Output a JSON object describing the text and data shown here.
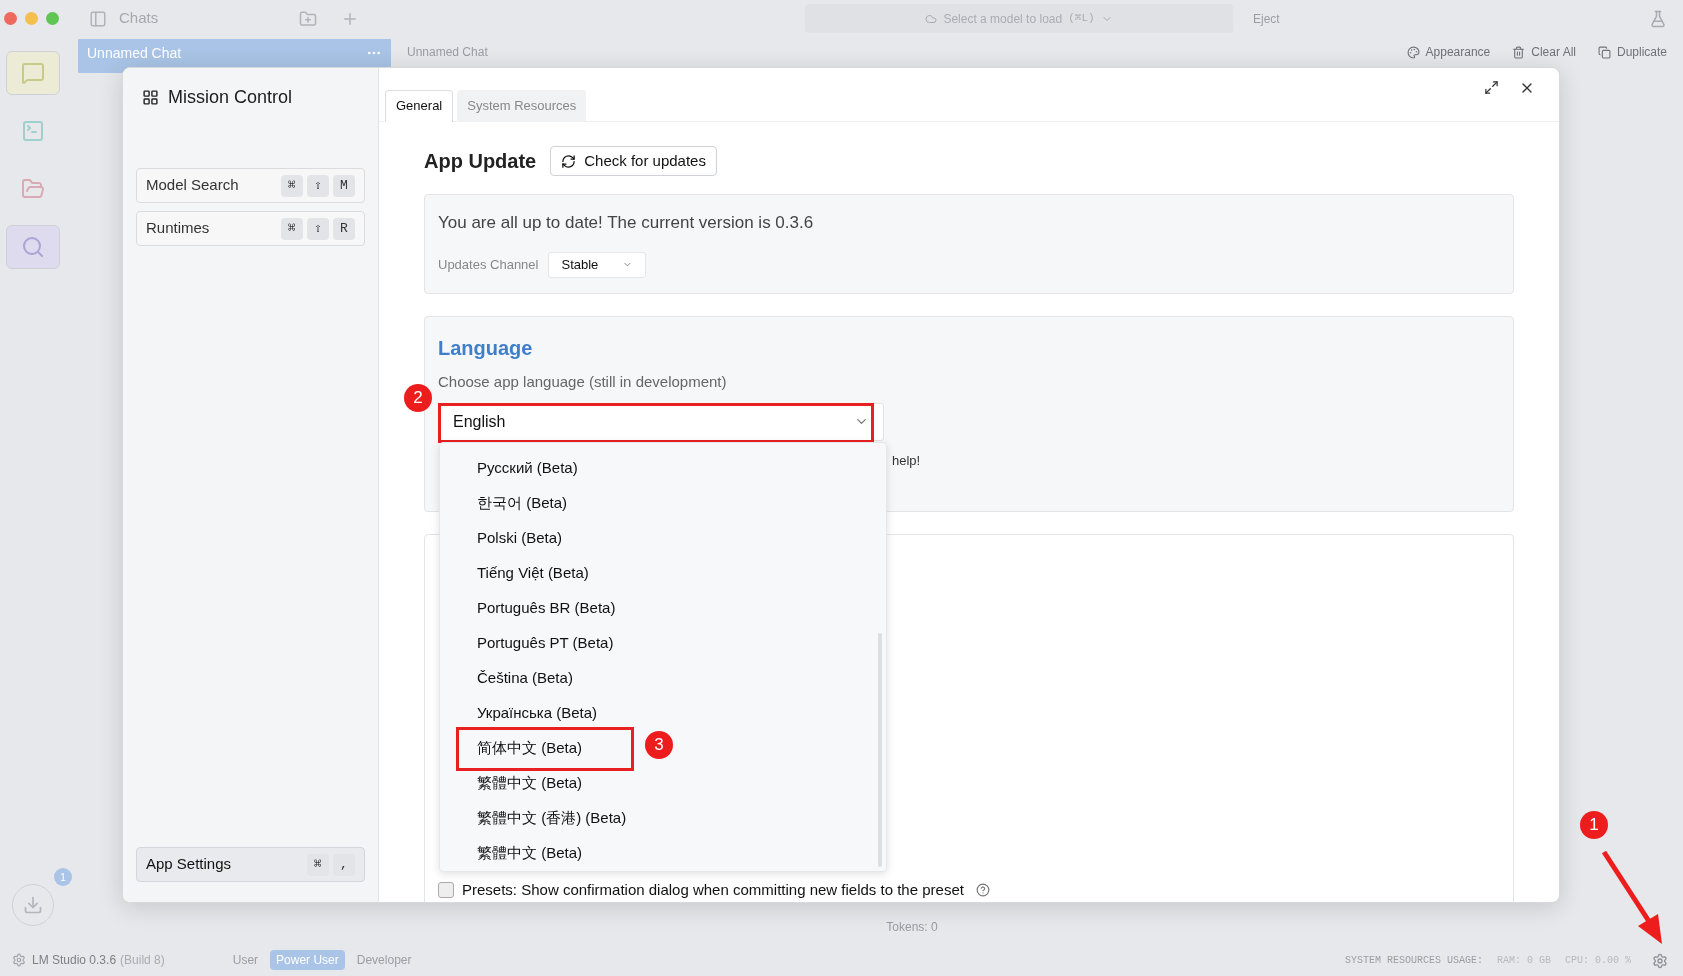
{
  "titlebar": {
    "title": "Chats",
    "model_picker": "Select a model to load",
    "model_shortcut": "(⌘L)",
    "eject": "Eject"
  },
  "sidebar": {
    "items": [
      {
        "kind": "chat",
        "highlighted": true
      },
      {
        "kind": "terminal",
        "highlighted": false
      },
      {
        "kind": "folder",
        "highlighted": false
      },
      {
        "kind": "search",
        "highlighted": true
      }
    ]
  },
  "chat_tabs": [
    {
      "label": "Unnamed Chat",
      "selected": true
    },
    {
      "label": "Unnamed Chat",
      "selected": false
    }
  ],
  "chat_actions": [
    {
      "kind": "appearance",
      "label": "Appearance"
    },
    {
      "kind": "clear",
      "label": "Clear All"
    },
    {
      "kind": "duplicate",
      "label": "Duplicate"
    }
  ],
  "tokens": "Tokens: 0",
  "downloads": {
    "badge": "1"
  },
  "status_bar": {
    "app": "LM Studio 0.3.6",
    "build": "(Build 8)",
    "modes": [
      {
        "label": "User",
        "selected": false
      },
      {
        "label": "Power User",
        "selected": true
      },
      {
        "label": "Developer",
        "selected": false
      }
    ],
    "resources_label": "SYSTEM RESOURCES USAGE:",
    "ram": "RAM: 0 GB",
    "cpu": "CPU: 0.00 %"
  },
  "dialog": {
    "title": "Mission Control",
    "nav": [
      {
        "label": "Model Search",
        "keys": [
          "⌘",
          "⇧",
          "M"
        ]
      },
      {
        "label": "Runtimes",
        "keys": [
          "⌘",
          "⇧",
          "R"
        ]
      }
    ],
    "footer_nav": {
      "label": "App Settings",
      "keys": [
        "⌘",
        ","
      ]
    },
    "tabs": [
      {
        "label": "General",
        "selected": true
      },
      {
        "label": "System Resources",
        "selected": false
      }
    ],
    "app_update": {
      "heading": "App Update",
      "button": "Check for updates",
      "status": "You are all up to date! The current version is 0.3.6",
      "channel_label": "Updates Channel",
      "channel_value": "Stable"
    },
    "language": {
      "heading": "Language",
      "description": "Choose app language (still in development)",
      "value": "English",
      "annotation": "2",
      "behind_text": "help!",
      "options": [
        {
          "label": "Русский (Beta)",
          "marked": false
        },
        {
          "label": "한국어 (Beta)",
          "marked": false
        },
        {
          "label": "Polski (Beta)",
          "marked": false
        },
        {
          "label": "Tiếng Việt (Beta)",
          "marked": false
        },
        {
          "label": "Português BR (Beta)",
          "marked": false
        },
        {
          "label": "Português PT (Beta)",
          "marked": false
        },
        {
          "label": "Čeština (Beta)",
          "marked": false
        },
        {
          "label": "Українська (Beta)",
          "marked": false
        },
        {
          "label": "简体中文 (Beta)",
          "marked": true,
          "annotation": "3"
        },
        {
          "label": "繁體中文 (Beta)",
          "marked": false
        },
        {
          "label": "繁體中文 (香港) (Beta)",
          "marked": false
        },
        {
          "label": "繁體中文 (Beta)",
          "marked": false
        }
      ]
    },
    "presets_option": {
      "label": "Presets: Show confirmation dialog when committing new fields to the preset",
      "checked": false
    }
  },
  "settings_annotation": "1"
}
